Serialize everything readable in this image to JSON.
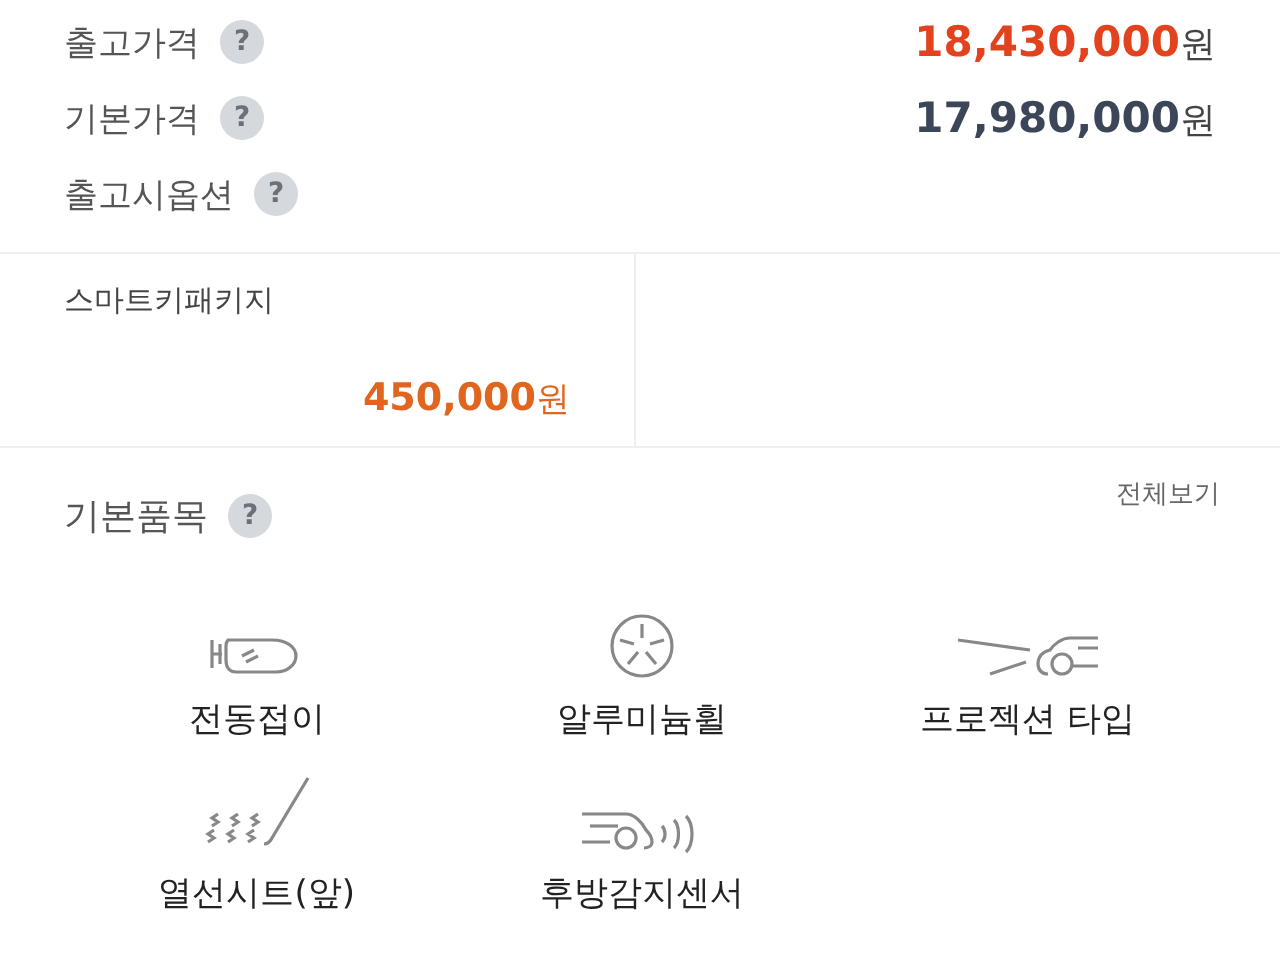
{
  "prices": [
    {
      "label": "출고가격",
      "help": "?",
      "amount": "**18,430,000**원",
      "color": "#e2431e"
    },
    {
      "label": "기본가격",
      "help": "?",
      "amount": "**17,980,000**원",
      "color": "#3b4758"
    },
    {
      "label": "출고시옵션",
      "help": "?"
    }
  ],
  "options": [
    {
      "name": "스마트키패키지",
      "price": "**450,000**원"
    }
  ],
  "basic_items": {
    "title": "기본품목",
    "help": "?",
    "view_all": "전체보기",
    "items": [
      {
        "kind": "mirror",
        "label": "전동접이"
      },
      {
        "kind": "wheel",
        "label": "알루미늄휠"
      },
      {
        "kind": "projection",
        "label": "프로젝션 타입"
      },
      {
        "kind": "heated-seat",
        "label": "열선시트(앞)"
      },
      {
        "kind": "rear-sensor",
        "label": "후방감지센서"
      }
    ]
  }
}
